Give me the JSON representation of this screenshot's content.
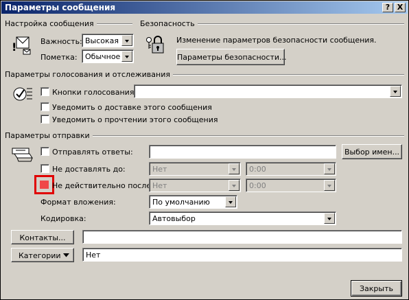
{
  "window": {
    "title": "Параметры сообщения",
    "help_label": "?",
    "close_label": "X"
  },
  "settings": {
    "group_title": "Настройка сообщения",
    "importance_label": "Важность:",
    "importance_value": "Высокая",
    "sensitivity_label": "Пометка:",
    "sensitivity_value": "Обычное"
  },
  "security": {
    "group_title": "Безопасность",
    "description": "Изменение параметров безопасности сообщения.",
    "button_label": "Параметры безопасности..."
  },
  "voting": {
    "group_title": "Параметры голосования и отслеживания",
    "voting_buttons_label": "Кнопки голосования:",
    "voting_buttons_value": "",
    "delivery_receipt_label": "Уведомить о доставке этого сообщения",
    "read_receipt_label": "Уведомить о прочтении этого сообщения"
  },
  "delivery": {
    "group_title": "Параметры отправки",
    "reply_to_label": "Отправлять ответы:",
    "reply_to_value": "",
    "select_names_label": "Выбор имен...",
    "deliver_after_label": "Не доставлять до:",
    "deliver_after_date": "Нет",
    "deliver_after_time": "0:00",
    "expires_label": "Не действительно после:",
    "expires_date": "Нет",
    "expires_time": "0:00",
    "attachment_format_label": "Формат вложения:",
    "attachment_format_value": "По умолчанию",
    "encoding_label": "Кодировка:",
    "encoding_value": "Автовыбор"
  },
  "contacts": {
    "button_label": "Контакты...",
    "value": ""
  },
  "categories": {
    "button_label": "Категории",
    "value": "Нет"
  },
  "footer": {
    "close_label": "Закрыть"
  },
  "colors": {
    "titlebar_start": "#0a246a",
    "titlebar_end": "#a6caf0",
    "face": "#d4d0c8",
    "highlight_box": "#e00000",
    "highlight_fill": "#f04848"
  }
}
